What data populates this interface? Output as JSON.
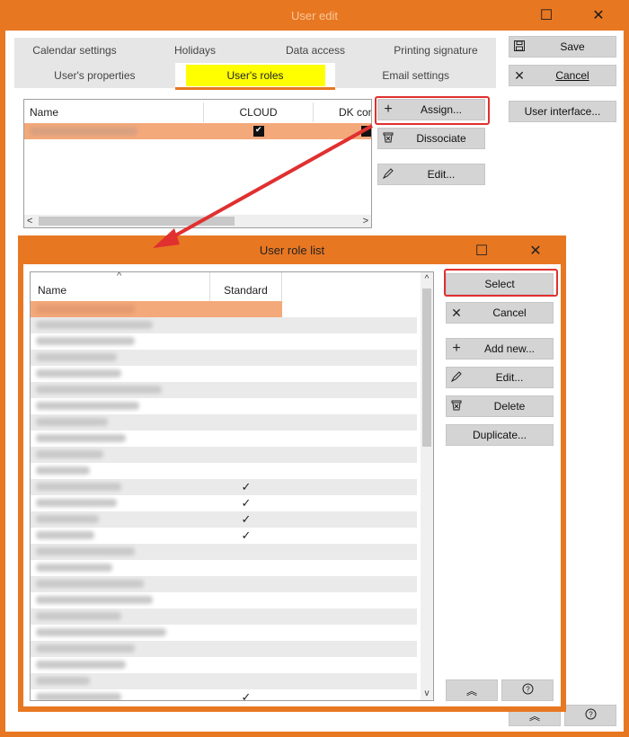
{
  "outer_window": {
    "title": "User edit",
    "maximize_glyph": "☐",
    "close_glyph": "✕"
  },
  "tabs": {
    "row1": [
      "Calendar settings",
      "Holidays",
      "Data access",
      "Printing signature"
    ],
    "row2": [
      "User's properties",
      "User's roles",
      "Email settings"
    ],
    "active": "User's roles"
  },
  "side_buttons": {
    "save": "Save",
    "cancel": "Cancel",
    "user_interface": "User interface..."
  },
  "role_buttons": {
    "assign": "Assign...",
    "dissociate": "Dissociate",
    "edit": "Edit..."
  },
  "roles_grid": {
    "columns": [
      "Name",
      "CLOUD",
      "DK con"
    ],
    "rows": [
      {
        "cloud": true,
        "dk": true
      }
    ]
  },
  "dialog": {
    "title": "User role list",
    "columns": [
      "Name",
      "Standard"
    ],
    "buttons": {
      "select": "Select",
      "cancel": "Cancel",
      "add_new": "Add new...",
      "edit": "Edit...",
      "delete": "Delete",
      "duplicate": "Duplicate..."
    },
    "standard_flags": [
      false,
      false,
      false,
      false,
      false,
      false,
      false,
      false,
      false,
      false,
      false,
      true,
      true,
      true,
      true,
      false,
      false,
      false,
      false,
      false,
      false,
      false,
      false,
      false,
      true
    ],
    "check_glyph": "✓"
  },
  "icons": {
    "save": "floppy-icon",
    "cancel": "close-icon",
    "assign": "plus-icon",
    "dissociate": "trash-icon",
    "edit": "pencil-icon",
    "collapse": "double-chevron-up-icon",
    "help": "help-icon"
  },
  "colors": {
    "accent": "#e87722",
    "selection": "#f4a97a",
    "highlight": "#ffff00",
    "annotation": "#e03030"
  }
}
